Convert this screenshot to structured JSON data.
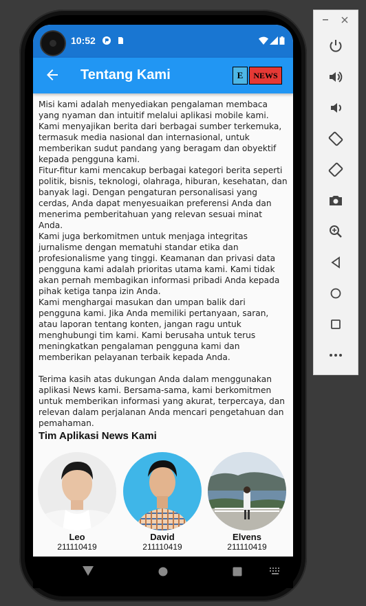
{
  "status_bar": {
    "time": "10:52"
  },
  "app_bar": {
    "title": "Tentang Kami",
    "logo_e": "E",
    "logo_news": "NEWS"
  },
  "paragraphs": [
    "Misi kami adalah menyediakan pengalaman membaca yang nyaman dan intuitif melalui aplikasi mobile kami. Kami menyajikan berita dari berbagai sumber terkemuka, termasuk media nasional dan internasional, untuk memberikan sudut pandang yang beragam dan obyektif kepada pengguna kami.",
    "Fitur-fitur kami mencakup berbagai kategori berita seperti politik, bisnis, teknologi, olahraga, hiburan, kesehatan, dan banyak lagi. Dengan pengaturan personalisasi yang cerdas, Anda dapat menyesuaikan preferensi Anda dan menerima pemberitahuan yang relevan sesuai minat Anda.",
    "Kami juga berkomitmen untuk menjaga integritas jurnalisme dengan mematuhi standar etika dan profesionalisme yang tinggi. Keamanan dan privasi data pengguna kami adalah prioritas utama kami. Kami tidak akan pernah membagikan informasi pribadi Anda kepada pihak ketiga tanpa izin Anda.",
    "Kami menghargai masukan dan umpan balik dari pengguna kami. Jika Anda memiliki pertanyaan, saran, atau laporan tentang konten, jangan ragu untuk menghubungi tim kami. Kami berusaha untuk terus meningkatkan pengalaman pengguna kami dan memberikan pelayanan terbaik kepada Anda.",
    "Terima kasih atas dukungan Anda dalam menggunakan aplikasi News kami. Bersama-sama, kami berkomitmen untuk memberikan informasi yang akurat, terpercaya, dan relevan dalam perjalanan Anda mencari pengetahuan dan pemahaman."
  ],
  "team": {
    "title": "Tim Aplikasi News Kami",
    "members": [
      {
        "name": "Leo",
        "id": "211110419"
      },
      {
        "name": "David",
        "id": "211110419"
      },
      {
        "name": "Elvens",
        "id": "211110419"
      }
    ]
  },
  "colors": {
    "status_bar": "#1976d2",
    "app_bar": "#2196f3",
    "logo_e": "#4db6e6",
    "logo_news": "#e53935"
  },
  "emulator_panel": {
    "icons": [
      "power-icon",
      "volume-up-icon",
      "volume-down-icon",
      "rotate-left-icon",
      "rotate-right-icon",
      "camera-icon",
      "zoom-icon",
      "back-icon",
      "home-icon",
      "overview-icon",
      "more-icon"
    ]
  }
}
